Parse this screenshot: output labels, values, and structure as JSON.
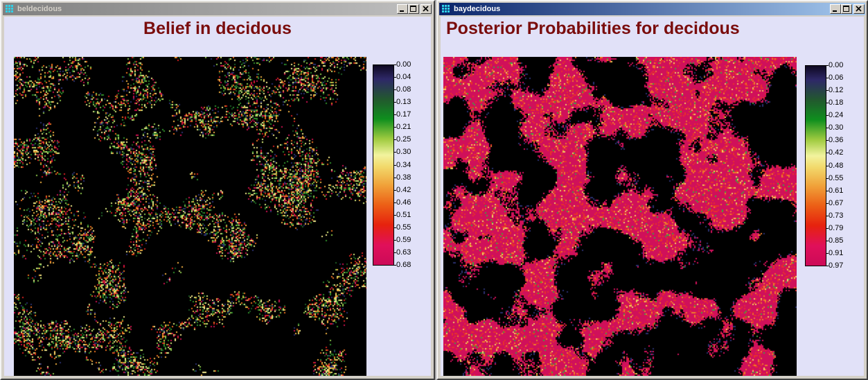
{
  "windows": [
    {
      "id": "left",
      "title": "beldecidous",
      "active": false,
      "plot_title": "Belief in decidous",
      "legend_ticks": [
        "0.00",
        "0.04",
        "0.08",
        "0.13",
        "0.17",
        "0.21",
        "0.25",
        "0.30",
        "0.34",
        "0.38",
        "0.42",
        "0.46",
        "0.51",
        "0.55",
        "0.59",
        "0.63",
        "0.68"
      ]
    },
    {
      "id": "right",
      "title": "baydecidous",
      "active": true,
      "plot_title": "Posterior Probabilities for decidous",
      "legend_ticks": [
        "0.00",
        "0.06",
        "0.12",
        "0.18",
        "0.24",
        "0.30",
        "0.36",
        "0.42",
        "0.48",
        "0.55",
        "0.61",
        "0.67",
        "0.73",
        "0.79",
        "0.85",
        "0.91",
        "0.97"
      ]
    }
  ],
  "colors": {
    "title_text": "#7a0d0d",
    "client_background": "#e1e1f8",
    "active_titlebar": "#0a246a",
    "inactive_titlebar": "#808080"
  },
  "icons": {
    "app": "grid-app-icon",
    "minimize": "minimize-icon",
    "maximize": "maximize-icon",
    "close": "close-icon"
  }
}
